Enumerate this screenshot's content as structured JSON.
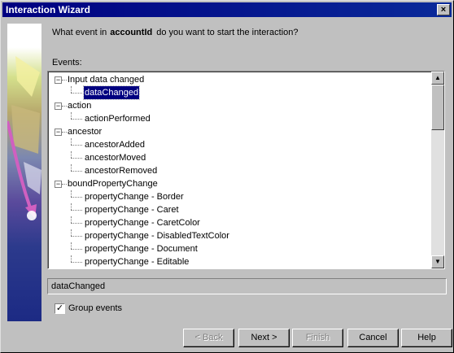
{
  "window": {
    "title": "Interaction Wizard",
    "close_glyph": "×"
  },
  "question": {
    "prefix": "What event in",
    "field": "accountId",
    "suffix": "do you want to start the interaction?"
  },
  "events_label": "Events:",
  "tree": {
    "items": [
      {
        "label": "Input data changed",
        "level": 0,
        "expander": "−"
      },
      {
        "label": "dataChanged",
        "level": 1,
        "selected": true
      },
      {
        "label": "action",
        "level": 0,
        "expander": "−"
      },
      {
        "label": "actionPerformed",
        "level": 1
      },
      {
        "label": "ancestor",
        "level": 0,
        "expander": "−"
      },
      {
        "label": "ancestorAdded",
        "level": 1
      },
      {
        "label": "ancestorMoved",
        "level": 1
      },
      {
        "label": "ancestorRemoved",
        "level": 1
      },
      {
        "label": "boundPropertyChange",
        "level": 0,
        "expander": "−"
      },
      {
        "label": "propertyChange - Border",
        "level": 1
      },
      {
        "label": "propertyChange - Caret",
        "level": 1
      },
      {
        "label": "propertyChange - CaretColor",
        "level": 1
      },
      {
        "label": "propertyChange - DisabledTextColor",
        "level": 1
      },
      {
        "label": "propertyChange - Document",
        "level": 1
      },
      {
        "label": "propertyChange - Editable",
        "level": 1
      }
    ]
  },
  "scrollbar": {
    "up_glyph": "▲",
    "down_glyph": "▼"
  },
  "selected_event": "dataChanged",
  "group_events": {
    "label": "Group events",
    "checked": true,
    "check_glyph": "✓"
  },
  "buttons": {
    "back": "< Back",
    "next": "Next >",
    "finish": "Finish",
    "cancel": "Cancel",
    "help": "Help"
  }
}
